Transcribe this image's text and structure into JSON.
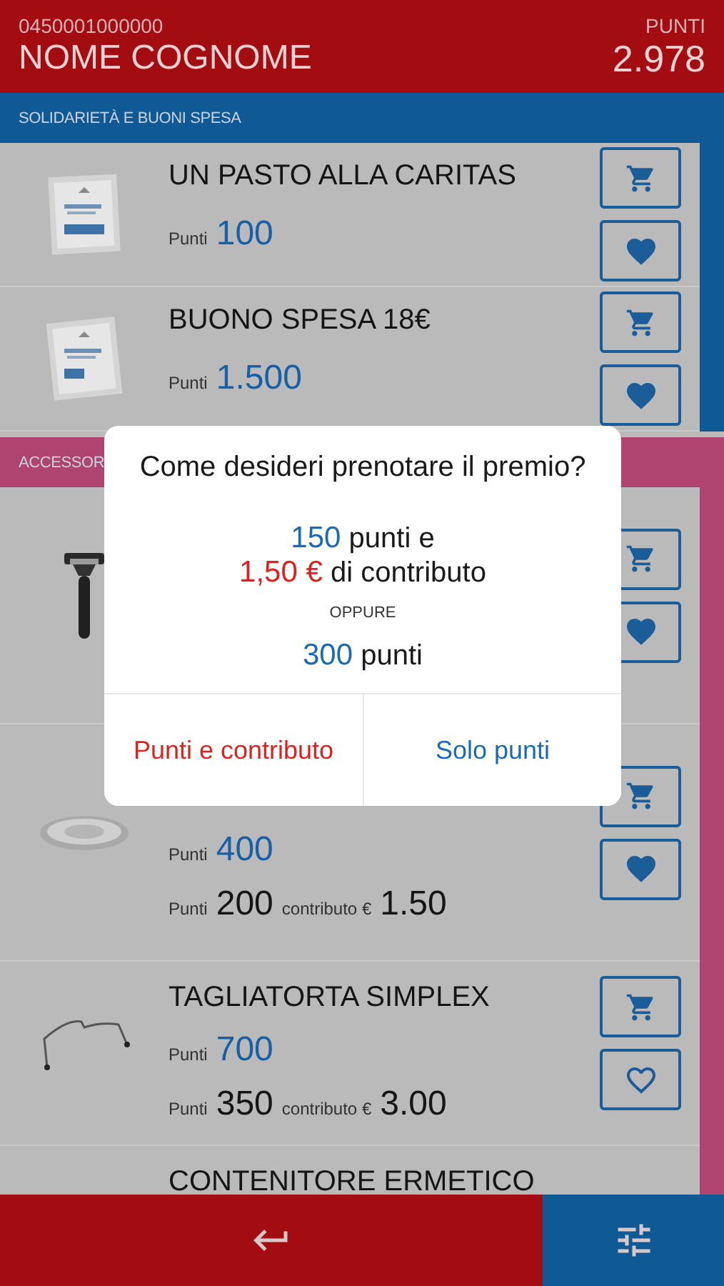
{
  "header": {
    "card_number": "0450001000000",
    "name": "NOME COGNOME",
    "points_label": "PUNTI",
    "points": "2.978"
  },
  "sections": [
    {
      "title": "SOLIDARIETÀ E BUONI SPESA",
      "color": "#0f5a94",
      "items": [
        {
          "kind": "voucher",
          "name": "UN PASTO ALLA CARITAS",
          "points_label": "Punti",
          "points": "100",
          "favorite": true
        },
        {
          "kind": "voucher",
          "name": "BUONO SPESA 18€",
          "points_label": "Punti",
          "points": "1.500",
          "favorite": true
        }
      ]
    },
    {
      "title": "ACCESSOR",
      "color": "#b04470",
      "items": [
        {
          "kind": "product",
          "favorite": true
        },
        {
          "kind": "product",
          "points_label": "Punti",
          "points": "400",
          "alt_points_label": "Punti",
          "alt_points": "200",
          "contribution_label": "contributo €",
          "contribution": "1.50",
          "favorite": true
        },
        {
          "kind": "product",
          "name": "TAGLIATORTA SIMPLEX",
          "points_label": "Punti",
          "points": "700",
          "alt_points_label": "Punti",
          "alt_points": "350",
          "contribution_label": "contributo €",
          "contribution": "3.00",
          "favorite": false
        },
        {
          "kind": "product",
          "name": "CONTENITORE ERMETICO"
        }
      ]
    }
  ],
  "dialog": {
    "title": "Come desideri prenotare il premio?",
    "mixed_points": "150",
    "mixed_points_label": "punti e",
    "contribution": "1,50  €",
    "contribution_label": "di contributo",
    "separator": "OPPURE",
    "only_points": "300",
    "only_points_label": "punti",
    "buttons": [
      {
        "label": "Punti e contributo",
        "kind": "contribution"
      },
      {
        "label": "Solo punti",
        "kind": "points"
      }
    ]
  },
  "bottom_bar": {
    "buttons": [
      {
        "kind": "back"
      },
      {
        "kind": "filter"
      }
    ]
  }
}
